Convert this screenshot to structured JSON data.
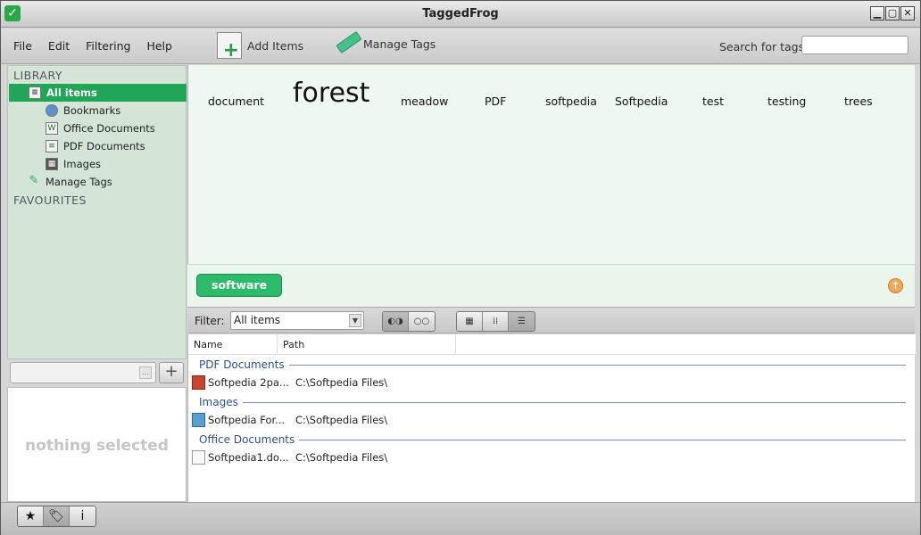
{
  "window": {
    "title": "TaggedFrog"
  },
  "menu": [
    "File",
    "Edit",
    "Filtering",
    "Help"
  ],
  "toolbar": {
    "add_items": "Add Items",
    "manage_tags": "Manage Tags",
    "search_label": "Search for tags",
    "search_value": ""
  },
  "sidebar": {
    "library_heading": "LIBRARY",
    "items": [
      {
        "label": "All items",
        "icon": "list-icon",
        "active": true
      },
      {
        "label": "Bookmarks",
        "icon": "globe-icon"
      },
      {
        "label": "Office Documents",
        "icon": "word-doc-icon"
      },
      {
        "label": "PDF Documents",
        "icon": "pdf-doc-icon"
      },
      {
        "label": "Images",
        "icon": "film-icon"
      },
      {
        "label": "Manage Tags",
        "icon": "pen-icon"
      }
    ],
    "favourites_heading": "FAVOURITES",
    "tag_filter_value": "",
    "info_text": "nothing selected"
  },
  "tag_cloud": [
    {
      "label": "document"
    },
    {
      "label": "forest",
      "emphasis": "large"
    },
    {
      "label": "meadow"
    },
    {
      "label": "PDF"
    },
    {
      "label": "softpedia"
    },
    {
      "label": "Softpedia"
    },
    {
      "label": "test"
    },
    {
      "label": "testing"
    },
    {
      "label": "trees"
    }
  ],
  "selected_tags": [
    "software"
  ],
  "filter": {
    "label": "Filter:",
    "value": "All items"
  },
  "list": {
    "columns": [
      "Name",
      "Path"
    ],
    "groups": [
      {
        "title": "PDF Documents",
        "rows": [
          {
            "name": "Softpedia 2pa...",
            "path": "C:\\Softpedia Files\\",
            "icon": "pdf-file-icon"
          }
        ]
      },
      {
        "title": "Images",
        "rows": [
          {
            "name": "Softpedia For...",
            "path": "C:\\Softpedia Files\\",
            "icon": "image-file-icon"
          }
        ]
      },
      {
        "title": "Office Documents",
        "rows": [
          {
            "name": "Softpedia1.do...",
            "path": "C:\\Softpedia Files\\",
            "icon": "text-file-icon"
          }
        ]
      }
    ]
  }
}
